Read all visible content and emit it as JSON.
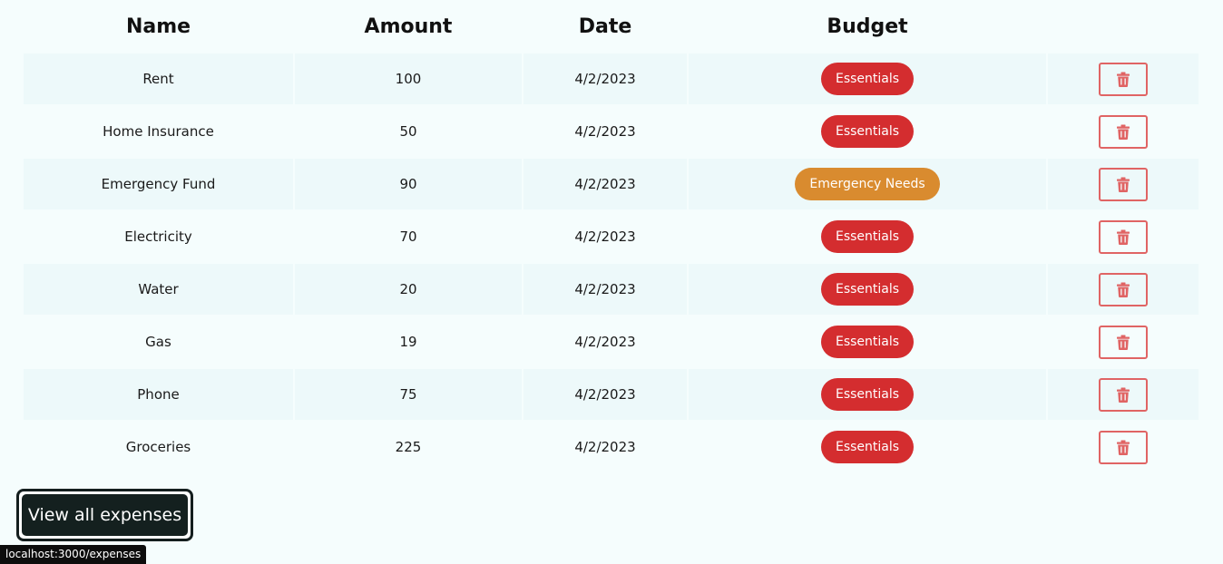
{
  "colors": {
    "essentials": "#d42d2f",
    "emergency_needs": "#d98b2f",
    "delete_border": "#e06464",
    "row_alt": "#edf9fa"
  },
  "table": {
    "headers": [
      "Name",
      "Amount",
      "Date",
      "Budget",
      ""
    ],
    "rows": [
      {
        "name": "Rent",
        "amount": "100",
        "date": "4/2/2023",
        "budget": "Essentials"
      },
      {
        "name": "Home Insurance",
        "amount": "50",
        "date": "4/2/2023",
        "budget": "Essentials"
      },
      {
        "name": "Emergency Fund",
        "amount": "90",
        "date": "4/2/2023",
        "budget": "Emergency Needs"
      },
      {
        "name": "Electricity",
        "amount": "70",
        "date": "4/2/2023",
        "budget": "Essentials"
      },
      {
        "name": "Water",
        "amount": "20",
        "date": "4/2/2023",
        "budget": "Essentials"
      },
      {
        "name": "Gas",
        "amount": "19",
        "date": "4/2/2023",
        "budget": "Essentials"
      },
      {
        "name": "Phone",
        "amount": "75",
        "date": "4/2/2023",
        "budget": "Essentials"
      },
      {
        "name": "Groceries",
        "amount": "225",
        "date": "4/2/2023",
        "budget": "Essentials"
      }
    ],
    "delete_icon": "trash-icon"
  },
  "actions": {
    "view_all_label": "View all expenses"
  },
  "status_bar": {
    "url": "localhost:3000/expenses"
  }
}
